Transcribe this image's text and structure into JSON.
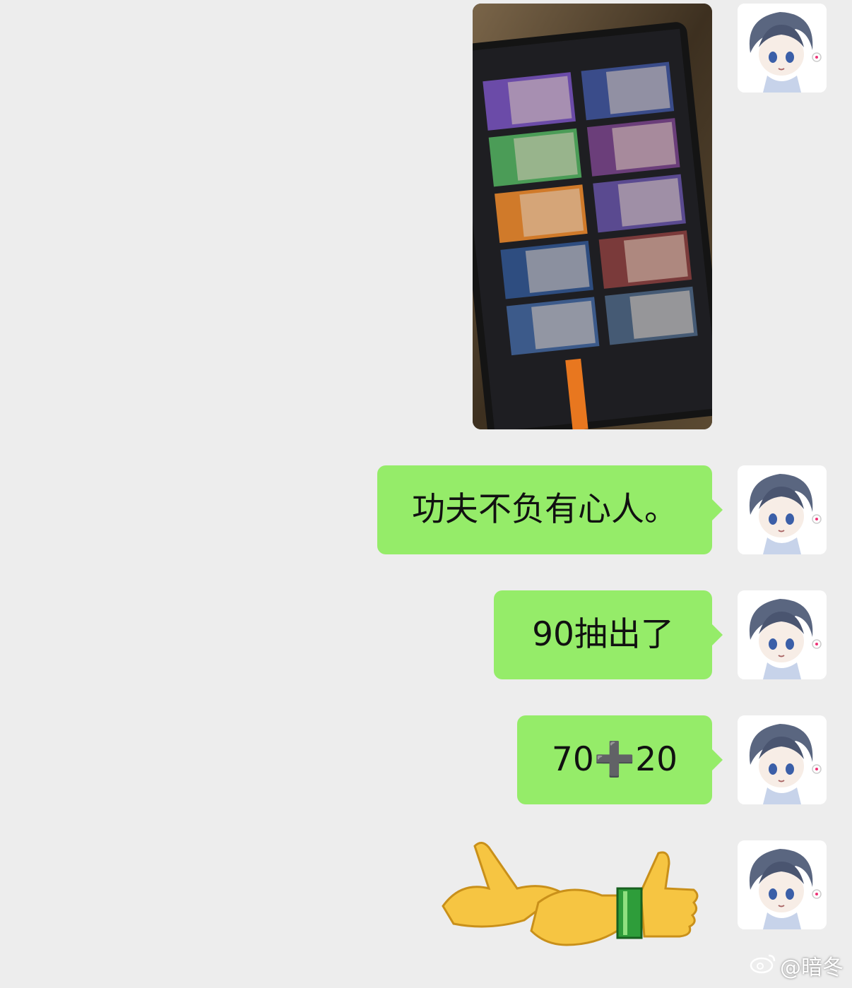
{
  "messages": [
    {
      "type": "image",
      "content_icon": "gacha-result-photo"
    },
    {
      "type": "text",
      "text": "功夫不负有心人。"
    },
    {
      "type": "text",
      "text": "90抽出了"
    },
    {
      "type": "text",
      "text": "70➕20"
    },
    {
      "type": "sticker",
      "content_icon": "handshake-thumbs-up-sticker"
    }
  ],
  "avatar_icon": "anime-avatar",
  "watermark": {
    "platform_icon": "weibo-icon",
    "text": "@暗冬"
  },
  "colors": {
    "background": "#ededed",
    "bubble": "#95ec69",
    "text": "#111111"
  }
}
